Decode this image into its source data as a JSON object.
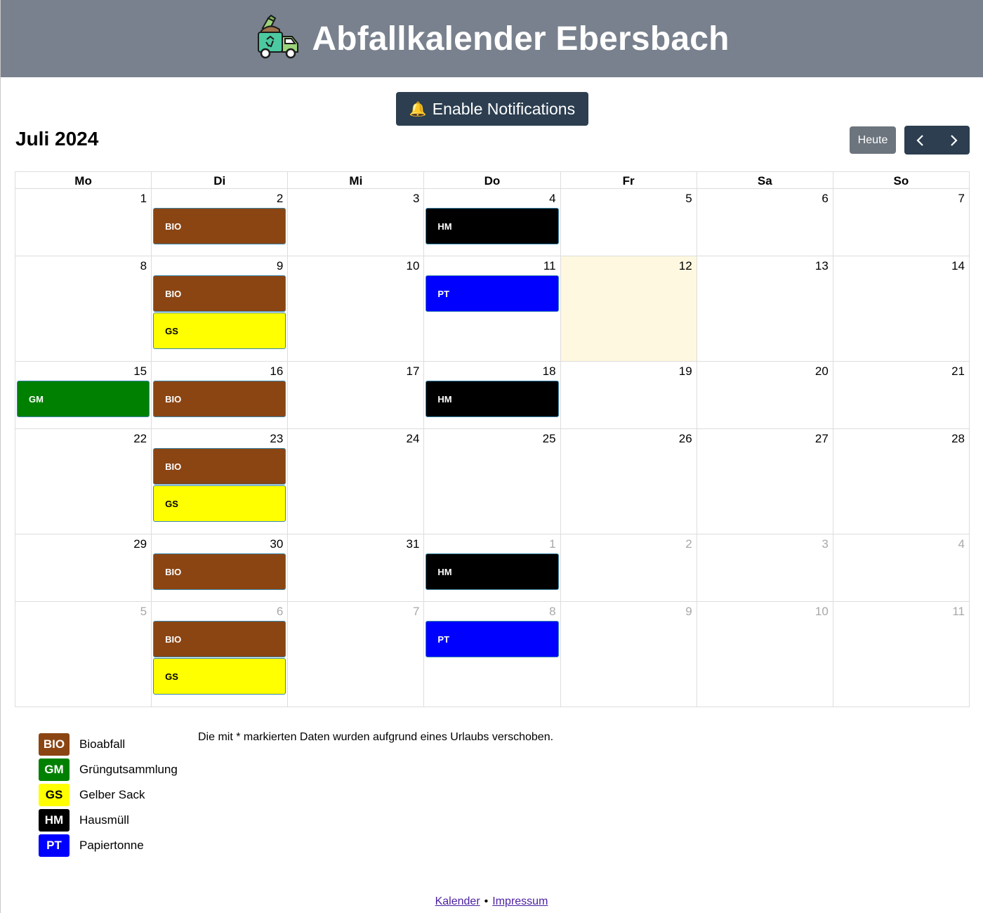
{
  "header": {
    "title": "Abfallkalender Ebersbach",
    "logo_icon": "garbage-truck-icon"
  },
  "notification_button": {
    "icon": "bell-icon",
    "label": "Enable Notifications"
  },
  "calendar": {
    "month_title": "Juli 2024",
    "today_label": "Heute",
    "weekdays": [
      "Mo",
      "Di",
      "Mi",
      "Do",
      "Fr",
      "Sa",
      "So"
    ],
    "weeks": [
      [
        {
          "day": "1",
          "events": []
        },
        {
          "day": "2",
          "events": [
            "BIO"
          ]
        },
        {
          "day": "3",
          "events": []
        },
        {
          "day": "4",
          "events": [
            "HM"
          ]
        },
        {
          "day": "5",
          "events": []
        },
        {
          "day": "6",
          "events": []
        },
        {
          "day": "7",
          "events": []
        }
      ],
      [
        {
          "day": "8",
          "events": []
        },
        {
          "day": "9",
          "events": [
            "BIO",
            "GS"
          ]
        },
        {
          "day": "10",
          "events": []
        },
        {
          "day": "11",
          "events": [
            "PT"
          ]
        },
        {
          "day": "12",
          "events": [],
          "today": true
        },
        {
          "day": "13",
          "events": []
        },
        {
          "day": "14",
          "events": []
        }
      ],
      [
        {
          "day": "15",
          "events": [
            "GM"
          ]
        },
        {
          "day": "16",
          "events": [
            "BIO"
          ]
        },
        {
          "day": "17",
          "events": []
        },
        {
          "day": "18",
          "events": [
            "HM"
          ]
        },
        {
          "day": "19",
          "events": []
        },
        {
          "day": "20",
          "events": []
        },
        {
          "day": "21",
          "events": []
        }
      ],
      [
        {
          "day": "22",
          "events": []
        },
        {
          "day": "23",
          "events": [
            "BIO",
            "GS"
          ]
        },
        {
          "day": "24",
          "events": []
        },
        {
          "day": "25",
          "events": []
        },
        {
          "day": "26",
          "events": []
        },
        {
          "day": "27",
          "events": []
        },
        {
          "day": "28",
          "events": []
        }
      ],
      [
        {
          "day": "29",
          "events": []
        },
        {
          "day": "30",
          "events": [
            "BIO"
          ]
        },
        {
          "day": "31",
          "events": []
        },
        {
          "day": "1",
          "events": [
            "HM"
          ],
          "other": true
        },
        {
          "day": "2",
          "events": [],
          "other": true
        },
        {
          "day": "3",
          "events": [],
          "other": true
        },
        {
          "day": "4",
          "events": [],
          "other": true
        }
      ],
      [
        {
          "day": "5",
          "events": [],
          "other": true
        },
        {
          "day": "6",
          "events": [
            "BIO",
            "GS"
          ],
          "other": true
        },
        {
          "day": "7",
          "events": [],
          "other": true
        },
        {
          "day": "8",
          "events": [
            "PT"
          ],
          "other": true
        },
        {
          "day": "9",
          "events": [],
          "other": true
        },
        {
          "day": "10",
          "events": [],
          "other": true
        },
        {
          "day": "11",
          "events": [],
          "other": true
        }
      ]
    ]
  },
  "event_types": {
    "BIO": {
      "label": "Bioabfall",
      "bg": "#8b4513",
      "fg": "#ffffff"
    },
    "GM": {
      "label": "Grüngutsammlung",
      "bg": "#008000",
      "fg": "#ffffff"
    },
    "GS": {
      "label": "Gelber Sack",
      "bg": "#ffff00",
      "fg": "#000000"
    },
    "HM": {
      "label": "Hausmüll",
      "bg": "#000000",
      "fg": "#ffffff"
    },
    "PT": {
      "label": "Papiertonne",
      "bg": "#0000ff",
      "fg": "#ffffff"
    }
  },
  "legend_order": [
    "BIO",
    "GM",
    "GS",
    "HM",
    "PT"
  ],
  "note": "Die mit * markierten Daten wurden aufgrund eines Urlaubs verschoben.",
  "footer": {
    "link_calendar": "Kalender",
    "separator": "•",
    "link_imprint": "Impressum"
  },
  "colors": {
    "header_bg": "#78818d",
    "primary_button": "#2c3e50",
    "today_cell": "#fef8e0"
  }
}
